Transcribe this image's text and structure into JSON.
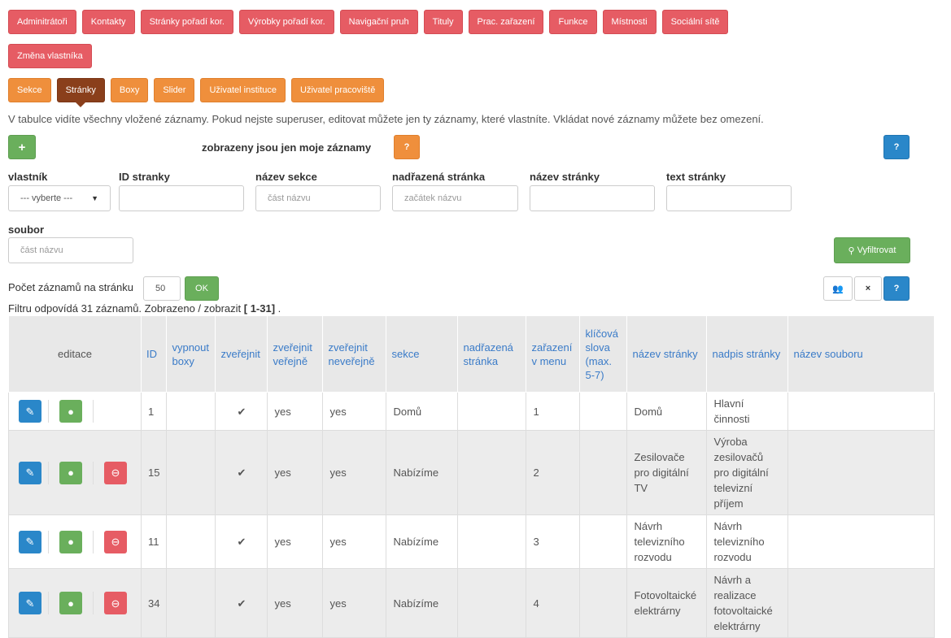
{
  "top_tabs_row1": [
    "Adminitrátoři",
    "Kontakty",
    "Stránky pořadí kor.",
    "Výrobky pořadí kor.",
    "Navigační pruh",
    "Tituly",
    "Prac. zařazení",
    "Funkce",
    "Místnosti",
    "Sociální sítě"
  ],
  "top_tabs_row2": [
    "Změna vlastníka"
  ],
  "section_tabs": [
    "Sekce",
    "Stránky",
    "Boxy",
    "Slider",
    "Uživatel instituce",
    "Uživatel pracoviště"
  ],
  "active_section_tab": "Stránky",
  "info_text": "V tabulce vidíte všechny vložené záznamy. Pokud nejste superuser, editovat můžete jen ty záznamy, které vlastníte. Vkládat nové záznamy můžete bez omezení.",
  "toolbar": {
    "add_label": "+",
    "own_only_label": "zobrazeny jsou jen moje záznamy",
    "question_label": "?"
  },
  "filters": {
    "owner": {
      "label": "vlastník",
      "value": "--- vyberte ---"
    },
    "page_id": {
      "label": "ID stranky",
      "placeholder": ""
    },
    "section_name": {
      "label": "název sekce",
      "placeholder": "část názvu"
    },
    "parent_page": {
      "label": "nadřazená stránka",
      "placeholder": "začátek názvu"
    },
    "page_name": {
      "label": "název stránky",
      "placeholder": ""
    },
    "page_text": {
      "label": "text stránky",
      "placeholder": ""
    },
    "file": {
      "label": "soubor",
      "placeholder": "část názvu"
    },
    "filter_button": "Vyfiltrovat"
  },
  "paging": {
    "label": "Počet záznamů na stránku",
    "value": "50",
    "ok_label": "OK",
    "result_text": "Filtru odpovídá 31 záznamů. Zobrazeno / zobrazit ",
    "range": "[ 1-31]",
    "range_suffix": " ."
  },
  "right_tools": {
    "users_icon": "users-icon",
    "close_label": "×",
    "help_label": "?"
  },
  "columns": [
    "editace",
    "ID",
    "vypnout boxy",
    "zveřejnit",
    "zveřejnit veřejně",
    "zveřejnit neveřejně",
    "sekce",
    "nadřazená stránka",
    "zařazení v menu",
    "klíčová slova (max. 5-7)",
    "název stránky",
    "nadpis stránky",
    "název souboru"
  ],
  "rows": [
    {
      "id": "1",
      "check": "✔",
      "public": "yes",
      "nonpublic": "yes",
      "section": "Domů",
      "menu": "1",
      "name": "Domů",
      "heading": "Hlavní činnosti",
      "deletable": false
    },
    {
      "id": "15",
      "check": "✔",
      "public": "yes",
      "nonpublic": "yes",
      "section": "Nabízíme",
      "menu": "2",
      "name": "Zesilovače pro digitální TV",
      "heading": "Výroba zesilovačů pro digitální televizní příjem",
      "deletable": true
    },
    {
      "id": "11",
      "check": "✔",
      "public": "yes",
      "nonpublic": "yes",
      "section": "Nabízíme",
      "menu": "3",
      "name": "Návrh televizního rozvodu",
      "heading": "Návrh televizního rozvodu",
      "deletable": true
    },
    {
      "id": "34",
      "check": "✔",
      "public": "yes",
      "nonpublic": "yes",
      "section": "Nabízíme",
      "menu": "4",
      "name": "Fotovoltaické elektrárny",
      "heading": "Návrh a realizace fotovoltaické elektrárny",
      "deletable": true
    }
  ],
  "colors": {
    "red": "#e65c64",
    "orange": "#ef8f3c",
    "active": "#8a3f1b",
    "green": "#6aaf5c",
    "blue": "#2a87c9"
  }
}
